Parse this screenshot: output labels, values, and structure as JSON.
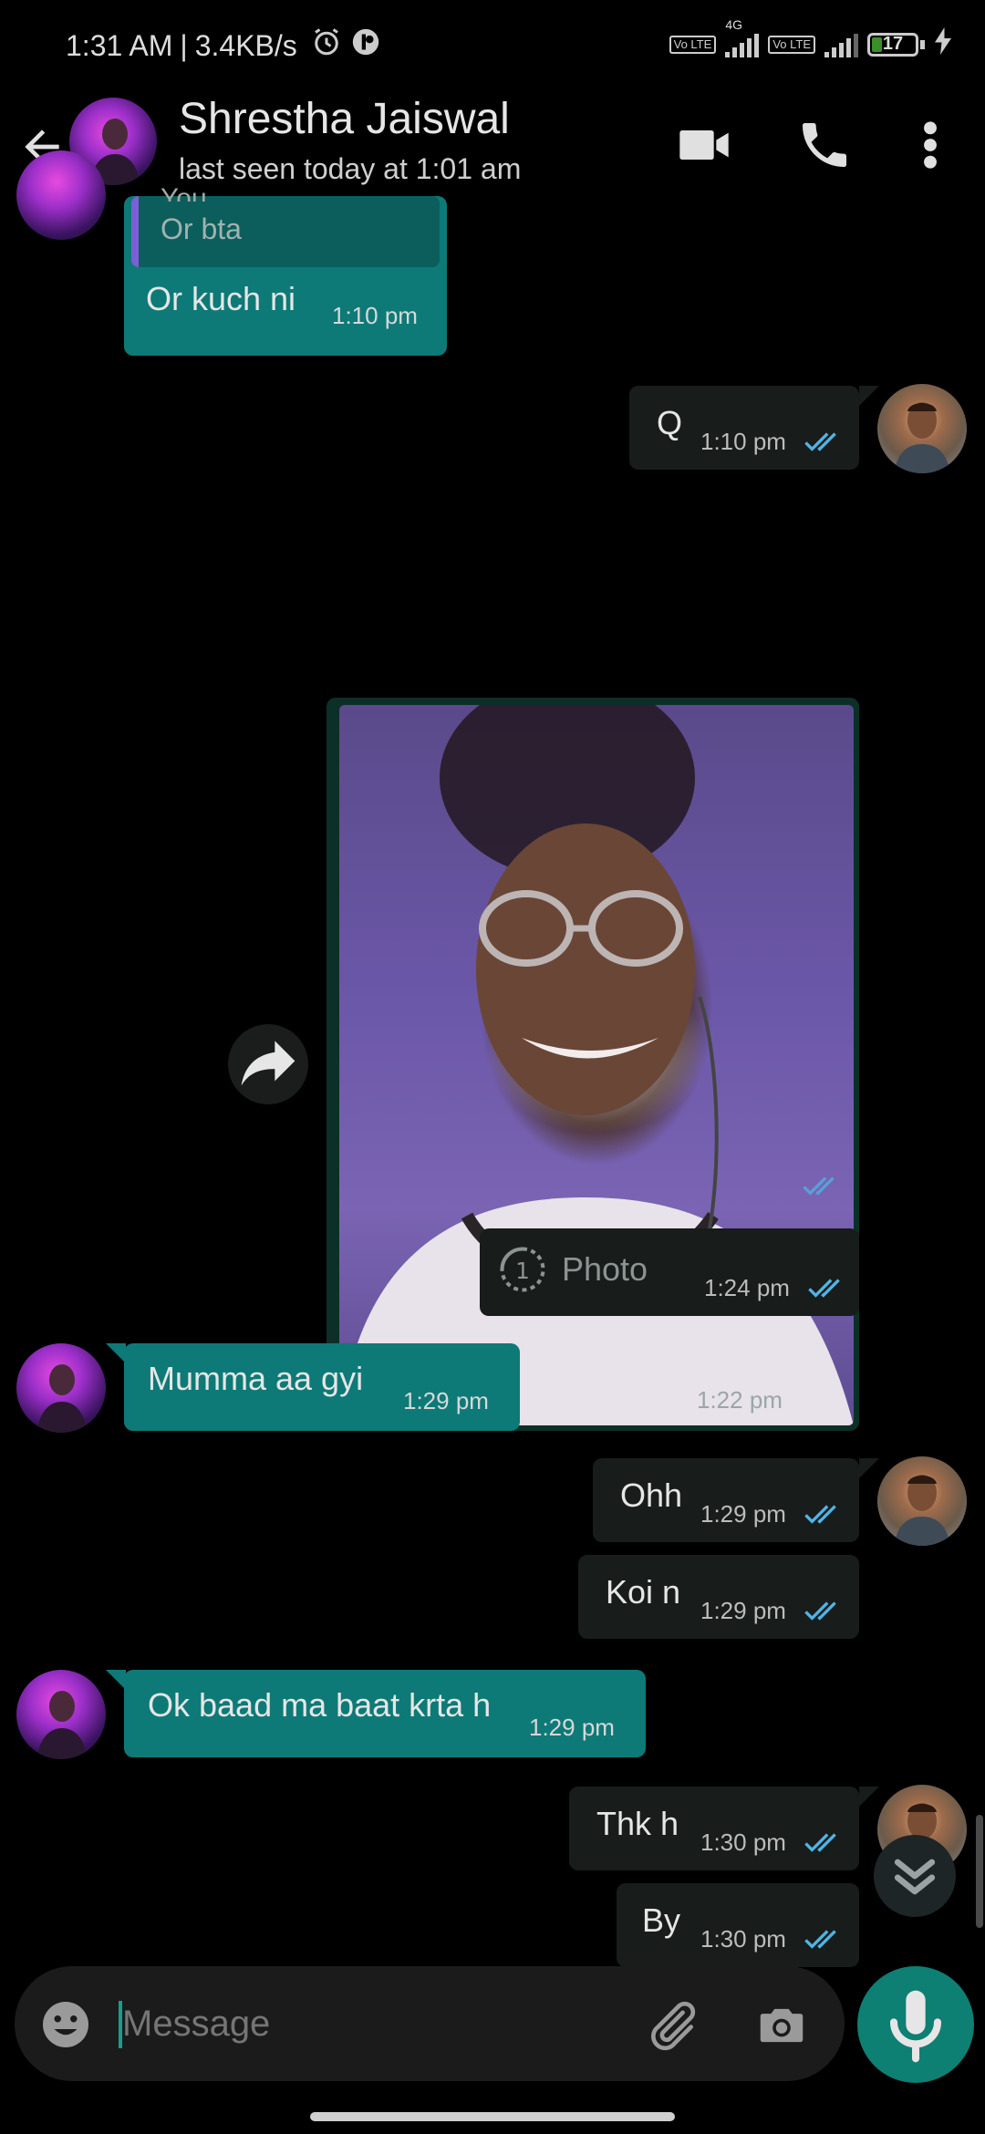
{
  "status_bar": {
    "time": "1:31 AM",
    "separator": "|",
    "speed": "3.4KB/s",
    "volte1": "Vo LTE",
    "network": "4G",
    "volte2": "Vo LTE",
    "battery": "17",
    "icons": [
      "alarm-icon",
      "app-notification-icon",
      "signal-icon",
      "battery-icon",
      "charging-icon"
    ]
  },
  "header": {
    "contact_name": "Shrestha Jaiswal",
    "last_seen": "last seen today at 1:01 am",
    "icons": [
      "back-arrow-icon",
      "video-call-icon",
      "voice-call-icon",
      "more-vert-icon"
    ]
  },
  "messages": [
    {
      "dir": "in",
      "quote_author": "You",
      "quote_text": "Or bta",
      "text": "Or kuch ni",
      "time": "1:10 pm"
    },
    {
      "dir": "out",
      "text": "Q",
      "time": "1:10 pm",
      "read": true
    },
    {
      "dir": "out",
      "type": "image",
      "time": "1:22 pm",
      "read": true
    },
    {
      "dir": "out",
      "type": "view-once",
      "text": "Photo",
      "time": "1:24 pm",
      "read": true
    },
    {
      "dir": "in",
      "text": "Mumma aa gyi",
      "time": "1:29 pm"
    },
    {
      "dir": "out",
      "text": "Ohh",
      "time": "1:29 pm",
      "read": true
    },
    {
      "dir": "out",
      "text": "Koi n",
      "time": "1:29 pm",
      "read": true
    },
    {
      "dir": "in",
      "text": "Ok baad ma baat krta h",
      "time": "1:29 pm"
    },
    {
      "dir": "out",
      "text": "Thk h",
      "time": "1:30 pm",
      "read": true
    },
    {
      "dir": "out",
      "text": "By",
      "time": "1:30 pm",
      "read": true
    }
  ],
  "composer": {
    "placeholder": "Message",
    "icons": [
      "emoji-icon",
      "attach-icon",
      "camera-icon",
      "mic-icon"
    ]
  },
  "colors": {
    "incoming_bubble": "#0d7a77",
    "outgoing_bubble": "#181c1b",
    "read_ticks": "#4fb4e6",
    "accent": "#0e7f73"
  }
}
